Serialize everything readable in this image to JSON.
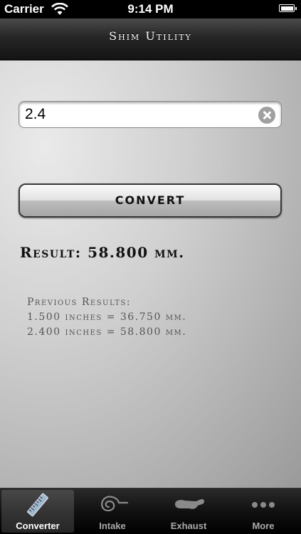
{
  "status_bar": {
    "carrier": "Carrier",
    "time": "9:14 PM"
  },
  "nav": {
    "title": "Shim Utility"
  },
  "input": {
    "value": "2.4"
  },
  "convert_button": {
    "label": "CONVERT"
  },
  "result": {
    "text": "Result: 58.800 mm."
  },
  "previous": {
    "title": "Previous Results:",
    "lines": [
      "1.500 inches = 36.750 mm.",
      "2.400 inches = 58.800 mm."
    ]
  },
  "tabs": [
    {
      "label": "Converter",
      "icon": "ruler-icon",
      "selected": true
    },
    {
      "label": "Intake",
      "icon": "swirl-icon",
      "selected": false
    },
    {
      "label": "Exhaust",
      "icon": "exhaust-icon",
      "selected": false
    },
    {
      "label": "More",
      "icon": "more-dots-icon",
      "selected": false
    }
  ],
  "colors": {
    "tab_selected_text": "#ffffff",
    "tab_text": "#aaaaaa"
  }
}
